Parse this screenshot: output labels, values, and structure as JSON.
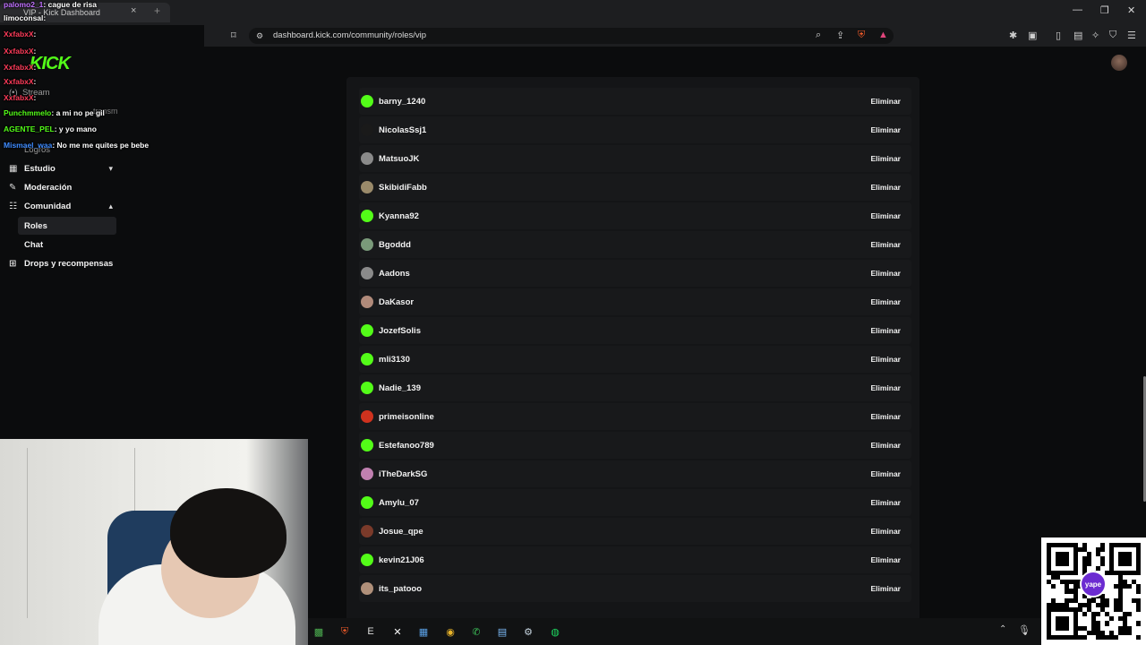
{
  "browser": {
    "tab_title": "VIP - Kick Dashboard",
    "url": "dashboard.kick.com/community/roles/vip",
    "tab_close": "×",
    "new_tab": "+"
  },
  "sidebar": {
    "logo": "KICK",
    "stream_label": "Stream",
    "transm_label": "transm",
    "logros_label": "Logros",
    "items": [
      {
        "label": "Estudio",
        "icon": "studio-icon",
        "chevron": "▾"
      },
      {
        "label": "Moderación",
        "icon": "wrench-icon"
      },
      {
        "label": "Comunidad",
        "icon": "community-icon",
        "chevron": "▴"
      },
      {
        "label": "Drops y recompensas",
        "icon": "gift-icon"
      }
    ],
    "sub_items": [
      {
        "label": "Roles",
        "active": true
      },
      {
        "label": "Chat",
        "active": false
      }
    ]
  },
  "chat_overlay": [
    {
      "user": "palomo2_1",
      "text": "cague de risa",
      "color": "#c070ff"
    },
    {
      "user": "limoconsal",
      "text": "",
      "color": "#ffffff"
    },
    {
      "user": "XxfabxX",
      "text": "",
      "color": "#ff3c5a"
    },
    {
      "user": "XxfabxX",
      "text": "",
      "color": "#ff3c5a"
    },
    {
      "user": "XxfabxX",
      "text": "",
      "color": "#ff3c5a"
    },
    {
      "user": "XxfabxX",
      "text": "",
      "color": "#ff3c5a"
    },
    {
      "user": "XxfabxX",
      "text": "",
      "color": "#ff3c5a"
    },
    {
      "user": "Punchmmelo",
      "text": "a mi no pe gil",
      "color": "#53fc18"
    },
    {
      "user": "AGENTE_PEL",
      "text": "y yo mano",
      "color": "#53fc18"
    },
    {
      "user": "Mismael_waa",
      "text": "No me me quites pe bebe",
      "color": "#3f8cff"
    }
  ],
  "vip_list": {
    "remove_label": "Eliminar",
    "users": [
      {
        "name": "barny_1240",
        "avatar_color": "#53fc18"
      },
      {
        "name": "NicolasSsj1",
        "avatar_color": "#1a1a1a"
      },
      {
        "name": "MatsuoJK",
        "avatar_color": "#8a8a8a"
      },
      {
        "name": "SkibidiFabb",
        "avatar_color": "#9a8a6a"
      },
      {
        "name": "Kyanna92",
        "avatar_color": "#53fc18"
      },
      {
        "name": "Bgoddd",
        "avatar_color": "#7a9a7a"
      },
      {
        "name": "Aadons",
        "avatar_color": "#8a8a8a"
      },
      {
        "name": "DaKasor",
        "avatar_color": "#b08a7a"
      },
      {
        "name": "JozefSolis",
        "avatar_color": "#53fc18"
      },
      {
        "name": "mli3130",
        "avatar_color": "#53fc18"
      },
      {
        "name": "Nadie_139",
        "avatar_color": "#53fc18"
      },
      {
        "name": "primeisonline",
        "avatar_color": "#d0321e"
      },
      {
        "name": "Estefanoo789",
        "avatar_color": "#53fc18"
      },
      {
        "name": "iTheDarkSG",
        "avatar_color": "#c080b0"
      },
      {
        "name": "Amylu_07",
        "avatar_color": "#53fc18"
      },
      {
        "name": "Josue_qpe",
        "avatar_color": "#7a3a2a"
      },
      {
        "name": "kevin21J06",
        "avatar_color": "#53fc18"
      },
      {
        "name": "its_patooo",
        "avatar_color": "#b0907a"
      }
    ]
  },
  "taskbar": {
    "icons": [
      "minecraft-icon",
      "brave-icon",
      "epic-icon",
      "xbox-icon",
      "calculator-icon",
      "chrome-icon",
      "whatsapp-icon",
      "notepad-icon",
      "steam-icon",
      "spotify-icon"
    ]
  },
  "qr": {
    "brand": "yape"
  }
}
